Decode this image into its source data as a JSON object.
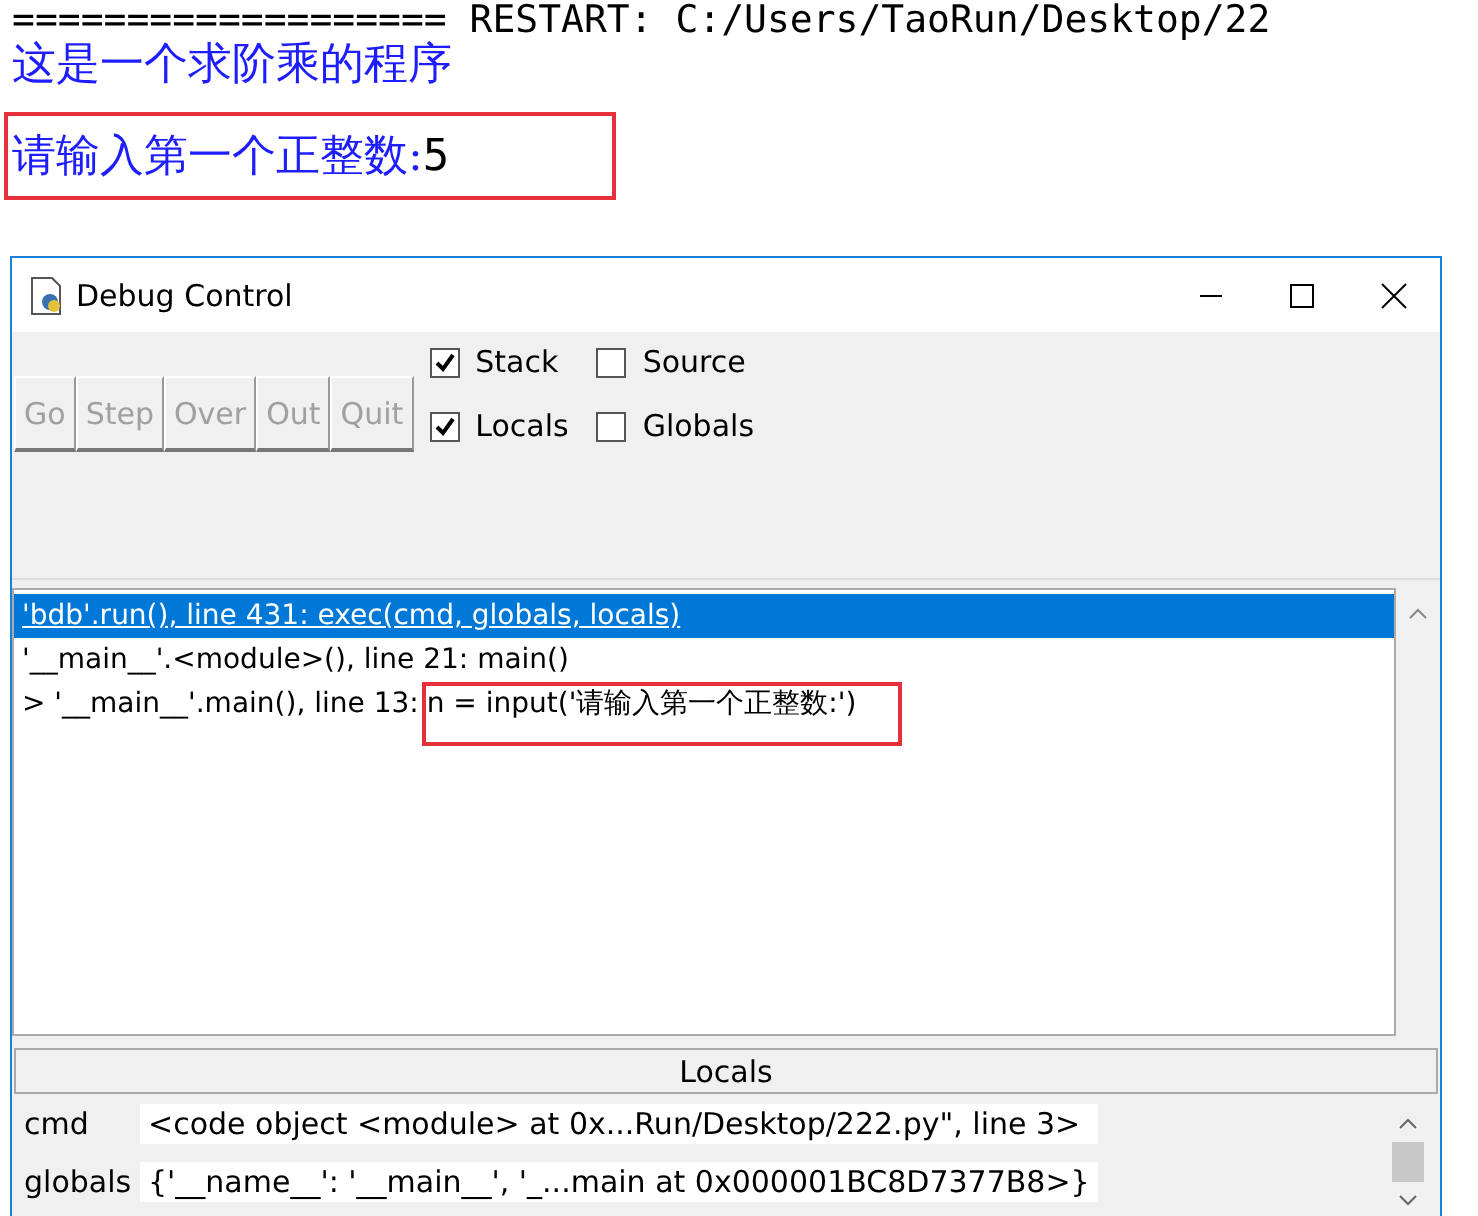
{
  "shell": {
    "lines": [
      {
        "kind": "banner",
        "text": "=================== RESTART: C:/Users/TaoRun/Desktop/22"
      },
      {
        "kind": "output",
        "text": "这是一个求阶乘的程序"
      },
      {
        "kind": "input",
        "prompt": "请输入第一个正整数:",
        "input": "5"
      }
    ]
  },
  "window": {
    "title": "Debug Control"
  },
  "buttons": [
    {
      "label": "Go",
      "disabled": true
    },
    {
      "label": "Step",
      "disabled": true
    },
    {
      "label": "Over",
      "disabled": true
    },
    {
      "label": "Out",
      "disabled": true
    },
    {
      "label": "Quit",
      "disabled": true
    }
  ],
  "checkboxes": [
    {
      "label": "Stack",
      "checked": true
    },
    {
      "label": "Source",
      "checked": false
    },
    {
      "label": "Locals",
      "checked": true
    },
    {
      "label": "Globals",
      "checked": false
    }
  ],
  "stack": [
    {
      "text": "'bdb'.run(), line 431: exec(cmd, globals, locals)",
      "selected": true
    },
    {
      "text": "'__main__'.<module>(), line 21: main()",
      "selected": false
    },
    {
      "text": "> '__main__'.main(), line 13:",
      "code": "n = input('请输入第一个正整数:')",
      "selected": false
    }
  ],
  "locals": {
    "title": "Locals",
    "rows": [
      {
        "name": "cmd",
        "value": "<code object <module> at 0x...Run/Desktop/222.py\", line 3>"
      },
      {
        "name": "globals",
        "value": "{'__name__': '__main__', '_...main at 0x000001BC8D7377B8>}"
      }
    ]
  }
}
